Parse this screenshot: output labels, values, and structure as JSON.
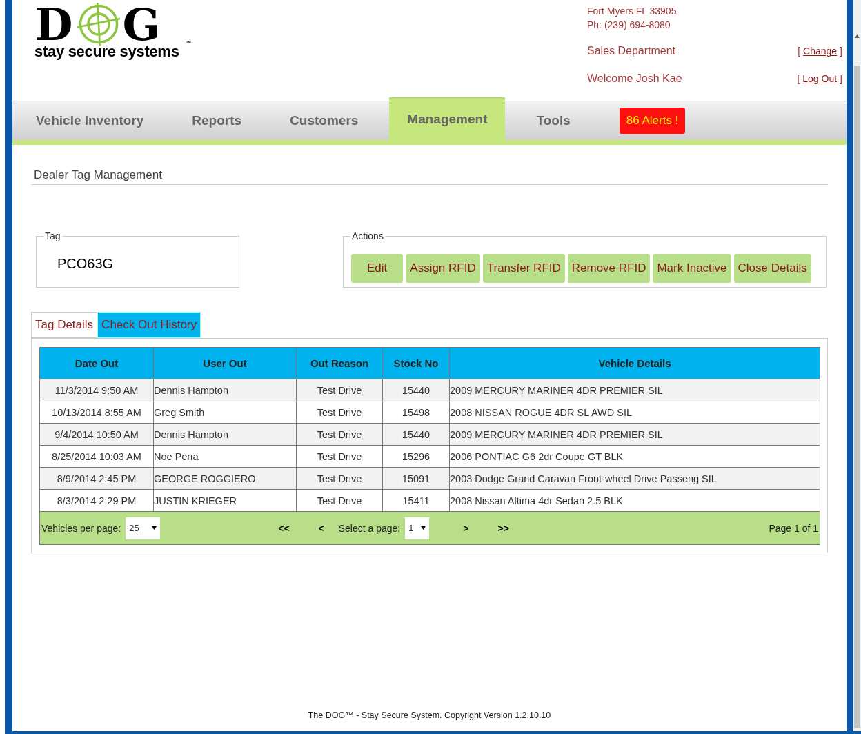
{
  "logo": {
    "letters": [
      "D",
      "G"
    ],
    "tagline": "stay secure systems",
    "trademark": "™"
  },
  "dealer": {
    "address_lines": [
      "Fort Myers FL 33905",
      "Ph: (239) 694-8080"
    ],
    "department": "Sales Department",
    "change_link": "Change",
    "welcome": "Welcome Josh Kae",
    "logout_link": "Log Out",
    "bracket_open": "[",
    "bracket_close": "]"
  },
  "nav": {
    "items": [
      {
        "label": "Vehicle Inventory",
        "selected": false
      },
      {
        "label": "Reports",
        "selected": false
      },
      {
        "label": "Customers",
        "selected": false
      },
      {
        "label": "Management",
        "selected": true
      },
      {
        "label": "Tools",
        "selected": false
      }
    ],
    "alerts": "86 Alerts !"
  },
  "page_title": "Dealer Tag Management",
  "tag": {
    "legend": "Tag",
    "value": "PCO63G"
  },
  "actions": {
    "legend": "Actions",
    "buttons": [
      "Edit",
      "Assign RFID",
      "Transfer RFID",
      "Remove RFID",
      "Mark Inactive",
      "Close Details"
    ]
  },
  "tabs": [
    {
      "label": "Tag Details",
      "selected": false
    },
    {
      "label": "Check Out History",
      "selected": true
    }
  ],
  "table": {
    "columns": [
      "Date Out",
      "User Out",
      "Out Reason",
      "Stock No",
      "Vehicle Details"
    ],
    "rows": [
      [
        "11/3/2014 9:50 AM",
        "Dennis Hampton",
        "Test Drive",
        "15440",
        "2009 MERCURY MARINER 4DR PREMIER SIL"
      ],
      [
        "10/13/2014 8:55 AM",
        "Greg Smith",
        "Test Drive",
        "15498",
        "2008 NISSAN ROGUE 4DR SL AWD SIL"
      ],
      [
        "9/4/2014 10:50 AM",
        "Dennis Hampton",
        "Test Drive",
        "15440",
        "2009 MERCURY MARINER 4DR PREMIER SIL"
      ],
      [
        "8/25/2014 10:03 AM",
        "Noe Pena",
        "Test Drive",
        "15296",
        "2006 PONTIAC G6 2dr Coupe GT BLK"
      ],
      [
        "8/9/2014 2:45 PM",
        "GEORGE ROGGIERO",
        "Test Drive",
        "15091",
        "2003 Dodge Grand Caravan Front-wheel Drive Passeng SIL"
      ],
      [
        "8/3/2014 2:29 PM",
        "JUSTIN KRIEGER",
        "Test Drive",
        "15411",
        "2008 Nissan Altima 4dr Sedan 2.5 BLK"
      ]
    ]
  },
  "pager": {
    "per_page_label": "Vehicles per page:",
    "per_page": "25",
    "first": "<<",
    "prev": "<",
    "select_label": "Select a page:",
    "page": "1",
    "next": ">",
    "last": ">>",
    "page_info": "Page 1 of 1"
  },
  "footer": "The DOG™ - Stay Secure System. Copyright Version 1.2.10.10"
}
